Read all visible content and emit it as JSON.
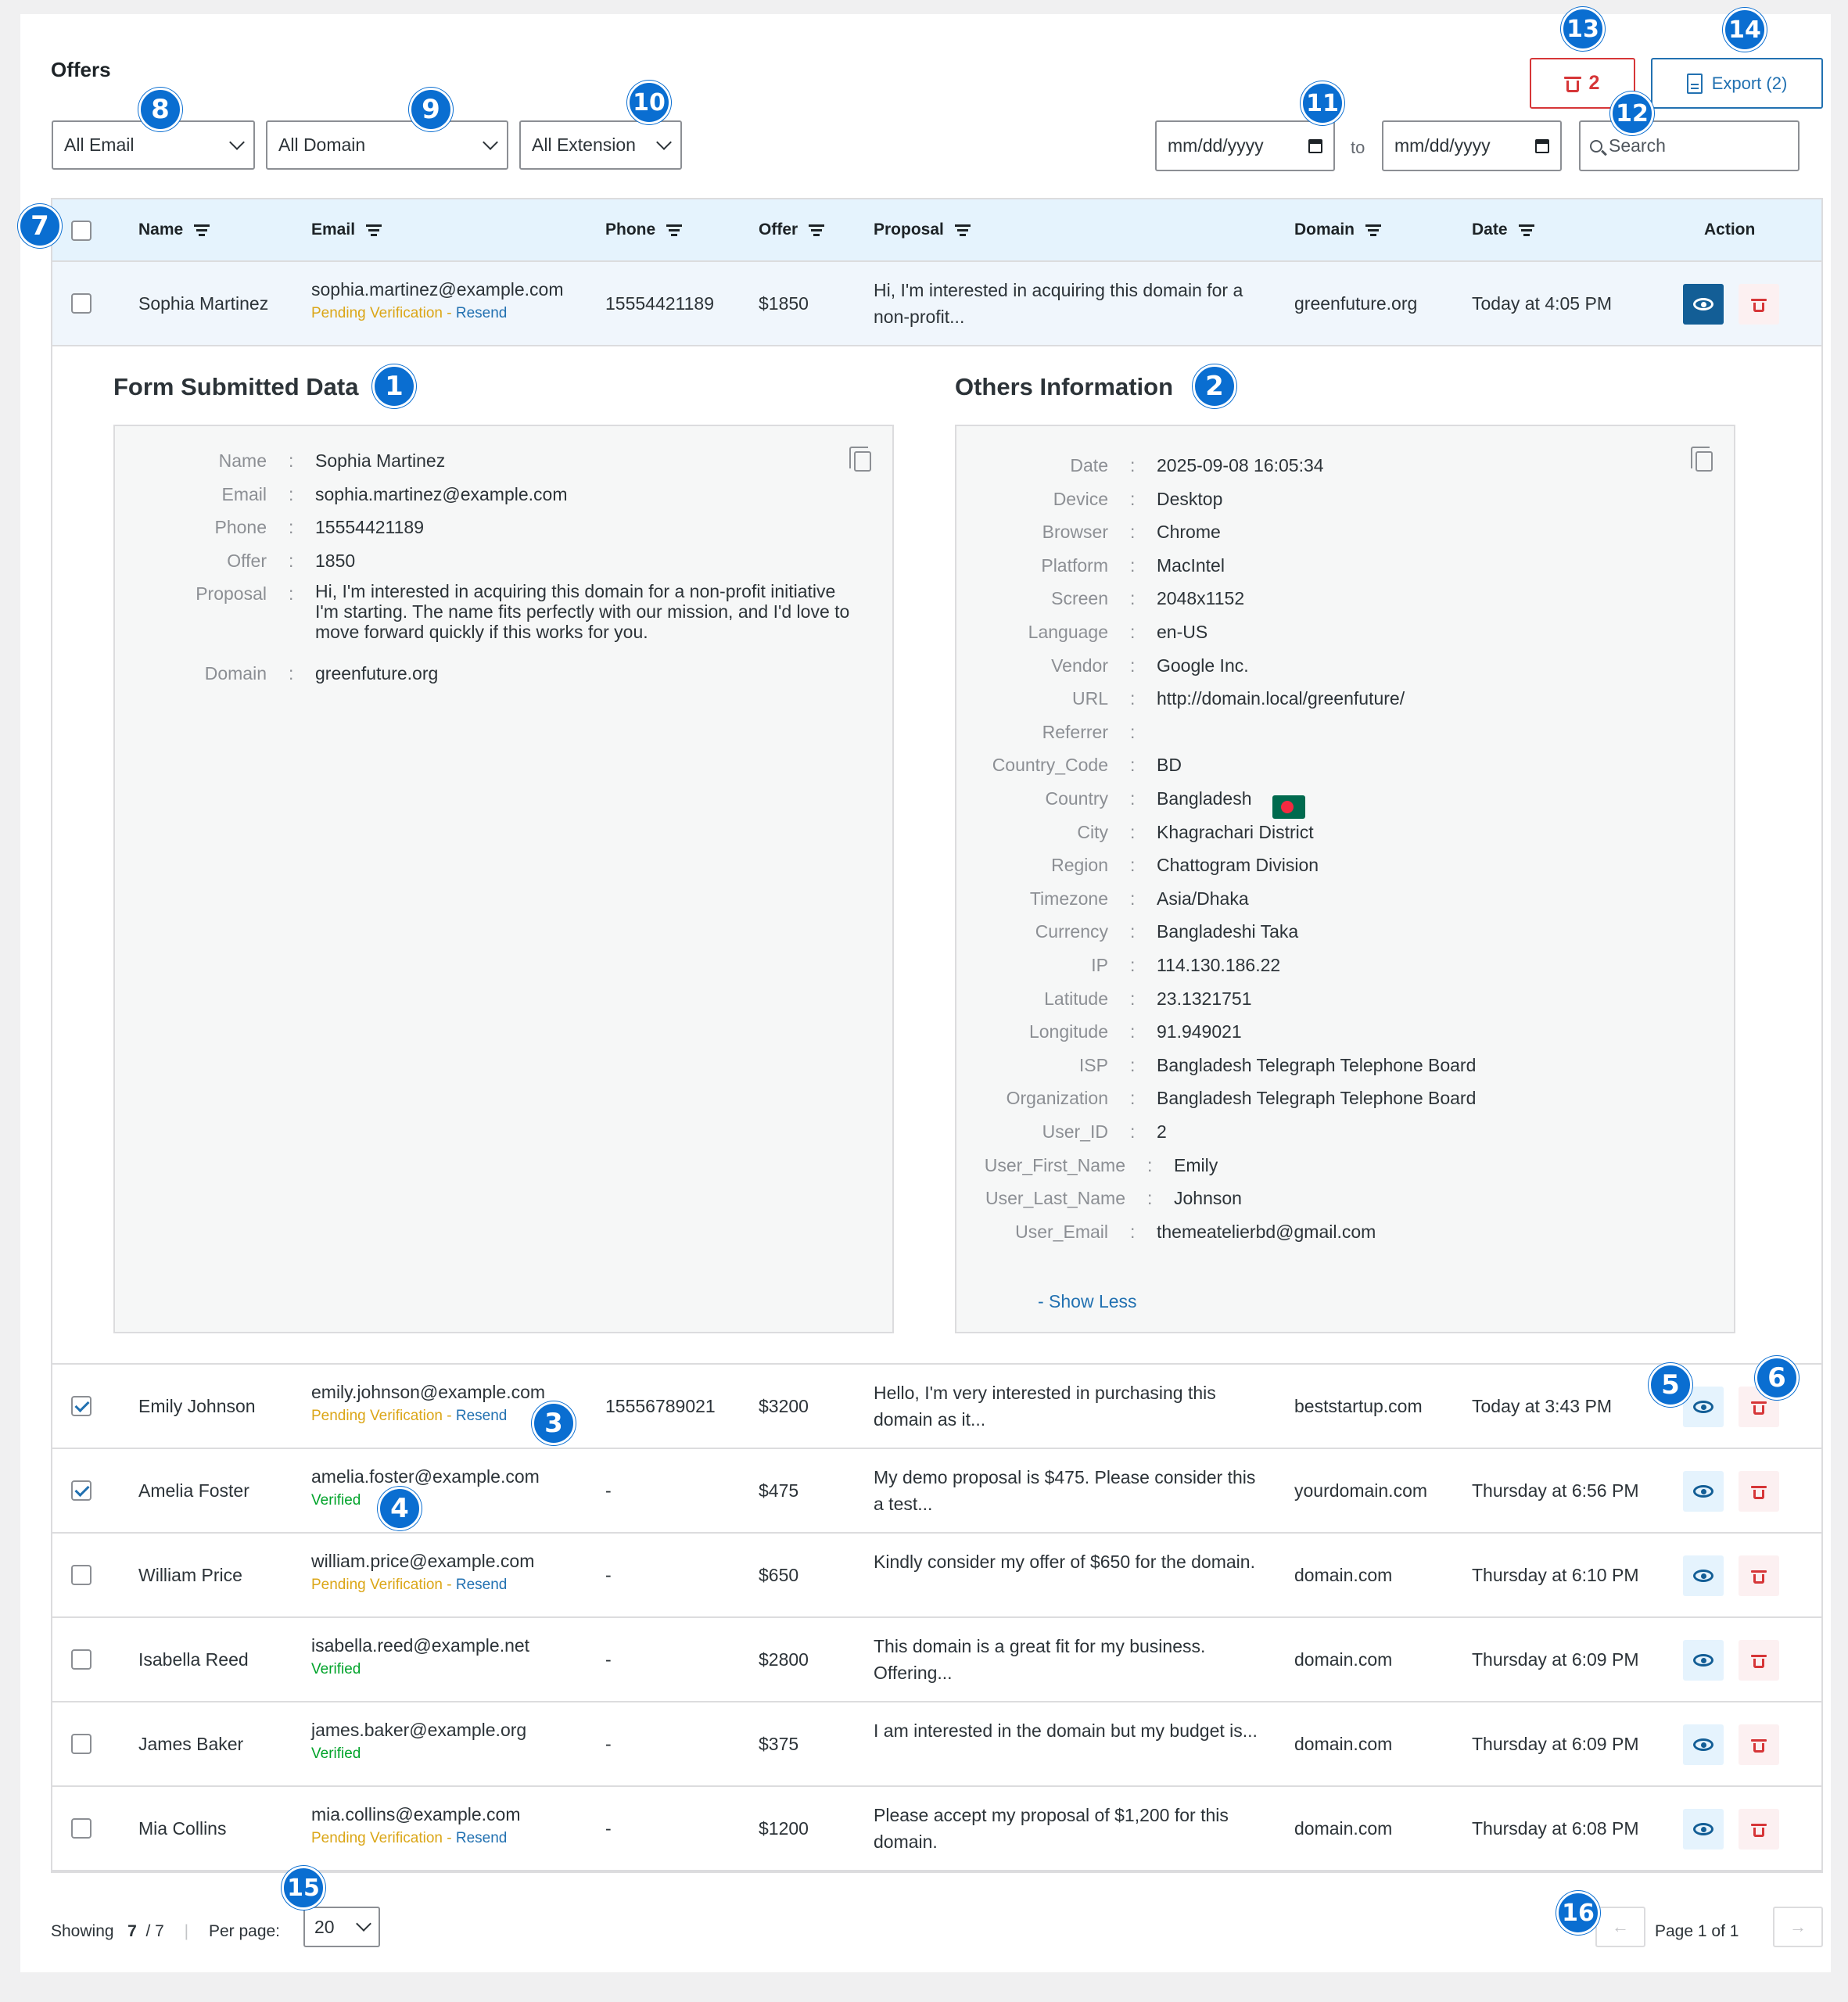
{
  "page": {
    "title": "Offers"
  },
  "filters": {
    "email": "All Email",
    "domain": "All Domain",
    "extension": "All Extension",
    "date_from": "mm/dd/yyyy",
    "date_to": "mm/dd/yyyy",
    "to_label": "to",
    "search_placeholder": "Search"
  },
  "toolbar": {
    "delete_count": "2",
    "export_label": "Export (2)"
  },
  "table": {
    "headers": {
      "name": "Name",
      "email": "Email",
      "phone": "Phone",
      "offer": "Offer",
      "proposal": "Proposal",
      "domain": "Domain",
      "date": "Date",
      "action": "Action"
    },
    "rows": [
      {
        "name": "Sophia Martinez",
        "email": "sophia.martinez@example.com",
        "status": "Pending Verification",
        "resend": "Resend",
        "phone": "15554421189",
        "offer": "$1850",
        "proposal": "Hi, I'm interested in acquiring this domain for a non-profit...",
        "domain": "greenfuture.org",
        "date": "Today at 4:05 PM"
      },
      {
        "name": "Emily Johnson",
        "email": "emily.johnson@example.com",
        "status": "Pending Verification",
        "resend": "Resend",
        "phone": "15556789021",
        "offer": "$3200",
        "proposal": "Hello, I'm very interested in purchasing this domain as it...",
        "domain": "beststartup.com",
        "date": "Today at 3:43 PM"
      },
      {
        "name": "Amelia Foster",
        "email": "amelia.foster@example.com",
        "status": "Verified",
        "resend": "",
        "phone": "-",
        "offer": "$475",
        "proposal": "My demo proposal is $475. Please consider this a test...",
        "domain": "yourdomain.com",
        "date": "Thursday at 6:56 PM"
      },
      {
        "name": "William Price",
        "email": "william.price@example.com",
        "status": "Pending Verification",
        "resend": "Resend",
        "phone": "-",
        "offer": "$650",
        "proposal": "Kindly consider my offer of $650 for the domain.",
        "domain": "domain.com",
        "date": "Thursday at 6:10 PM"
      },
      {
        "name": "Isabella Reed",
        "email": "isabella.reed@example.net",
        "status": "Verified",
        "resend": "",
        "phone": "-",
        "offer": "$2800",
        "proposal": "This domain is a great fit for my business. Offering...",
        "domain": "domain.com",
        "date": "Thursday at 6:09 PM"
      },
      {
        "name": "James Baker",
        "email": "james.baker@example.org",
        "status": "Verified",
        "resend": "",
        "phone": "-",
        "offer": "$375",
        "proposal": "I am interested in the domain but my budget is...",
        "domain": "domain.com",
        "date": "Thursday at 6:09 PM"
      },
      {
        "name": "Mia Collins",
        "email": "mia.collins@example.com",
        "status": "Pending Verification",
        "resend": "Resend",
        "phone": "-",
        "offer": "$1200",
        "proposal": "Please accept my proposal of $1,200 for this domain.",
        "domain": "domain.com",
        "date": "Thursday at 6:08 PM"
      }
    ]
  },
  "details": {
    "form_title": "Form Submitted Data",
    "others_title": "Others Information",
    "form": [
      {
        "k": "Name",
        "v": "Sophia Martinez"
      },
      {
        "k": "Email",
        "v": "sophia.martinez@example.com"
      },
      {
        "k": "Phone",
        "v": "15554421189"
      },
      {
        "k": "Offer",
        "v": "1850"
      },
      {
        "k": "Proposal",
        "v": "Hi, I'm interested in acquiring this domain for a non-profit initiative I'm starting. The name fits perfectly with our mission, and I'd love to move forward quickly if this works for you."
      },
      {
        "k": "Domain",
        "v": "greenfuture.org"
      }
    ],
    "others": [
      {
        "k": "Date",
        "v": "2025-09-08 16:05:34"
      },
      {
        "k": "Device",
        "v": "Desktop"
      },
      {
        "k": "Browser",
        "v": "Chrome"
      },
      {
        "k": "Platform",
        "v": "MacIntel"
      },
      {
        "k": "Screen",
        "v": "2048x1152"
      },
      {
        "k": "Language",
        "v": "en-US"
      },
      {
        "k": "Vendor",
        "v": "Google Inc."
      },
      {
        "k": "URL",
        "v": "http://domain.local/greenfuture/"
      },
      {
        "k": "Referrer",
        "v": ""
      },
      {
        "k": "Country_Code",
        "v": "BD"
      },
      {
        "k": "Country",
        "v": "Bangladesh"
      },
      {
        "k": "City",
        "v": "Khagrachari District"
      },
      {
        "k": "Region",
        "v": "Chattogram Division"
      },
      {
        "k": "Timezone",
        "v": "Asia/Dhaka"
      },
      {
        "k": "Currency",
        "v": "Bangladeshi Taka"
      },
      {
        "k": "IP",
        "v": "114.130.186.22"
      },
      {
        "k": "Latitude",
        "v": "23.1321751"
      },
      {
        "k": "Longitude",
        "v": "91.949021"
      },
      {
        "k": "ISP",
        "v": "Bangladesh Telegraph Telephone Board"
      },
      {
        "k": "Organization",
        "v": "Bangladesh Telegraph Telephone Board"
      },
      {
        "k": "User_ID",
        "v": "2"
      },
      {
        "k": "User_First_Name",
        "v": "Emily"
      },
      {
        "k": "User_Last_Name",
        "v": "Johnson"
      },
      {
        "k": "User_Email",
        "v": "themeatelierbd@gmail.com"
      }
    ],
    "show_less": "- Show Less"
  },
  "footer": {
    "showing_label": "Showing",
    "showing_count": "7",
    "showing_total": "/ 7",
    "per_page_label": "Per page:",
    "per_page_value": "20",
    "page_label": "Page 1 of 1",
    "prev_icon": "arrow-left-icon",
    "next_icon": "arrow-right-icon"
  },
  "badges": [
    "1",
    "2",
    "3",
    "4",
    "5",
    "6",
    "7",
    "8",
    "9",
    "10",
    "11",
    "12",
    "13",
    "14",
    "15",
    "16"
  ],
  "colors": {
    "accent": "#2271b1",
    "danger": "#d63638",
    "badge": "#0a6ed1",
    "header_bg": "#e5f3fd"
  }
}
